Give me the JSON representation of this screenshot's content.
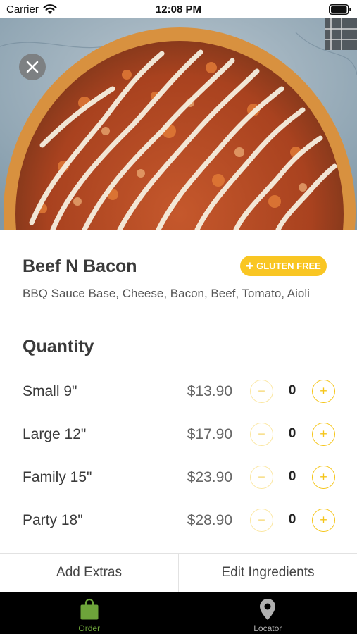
{
  "status_bar": {
    "carrier": "Carrier",
    "time": "12:08 PM"
  },
  "product": {
    "name": "Beef N Bacon",
    "badge": "GLUTEN FREE",
    "badge_color": "#f9c623",
    "description": "BBQ Sauce Base, Cheese, Bacon, Beef, Tomato, Aioli"
  },
  "quantity": {
    "heading": "Quantity",
    "sizes": [
      {
        "name": "Small 9\"",
        "price": "$13.90",
        "qty": "0"
      },
      {
        "name": "Large 12\"",
        "price": "$17.90",
        "qty": "0"
      },
      {
        "name": "Family 15\"",
        "price": "$23.90",
        "qty": "0"
      },
      {
        "name": "Party 18\"",
        "price": "$28.90",
        "qty": "0"
      }
    ],
    "minus_symbol": "−",
    "plus_symbol": "+"
  },
  "actions": {
    "add_extras": "Add Extras",
    "edit_ingredients": "Edit Ingredients"
  },
  "tabs": [
    {
      "label": "Order",
      "icon": "shopping-bag-icon",
      "active": true
    },
    {
      "label": "Locator",
      "icon": "map-pin-icon",
      "active": false
    }
  ],
  "colors": {
    "accent_yellow": "#f5c518",
    "tab_active": "#6da43a"
  }
}
